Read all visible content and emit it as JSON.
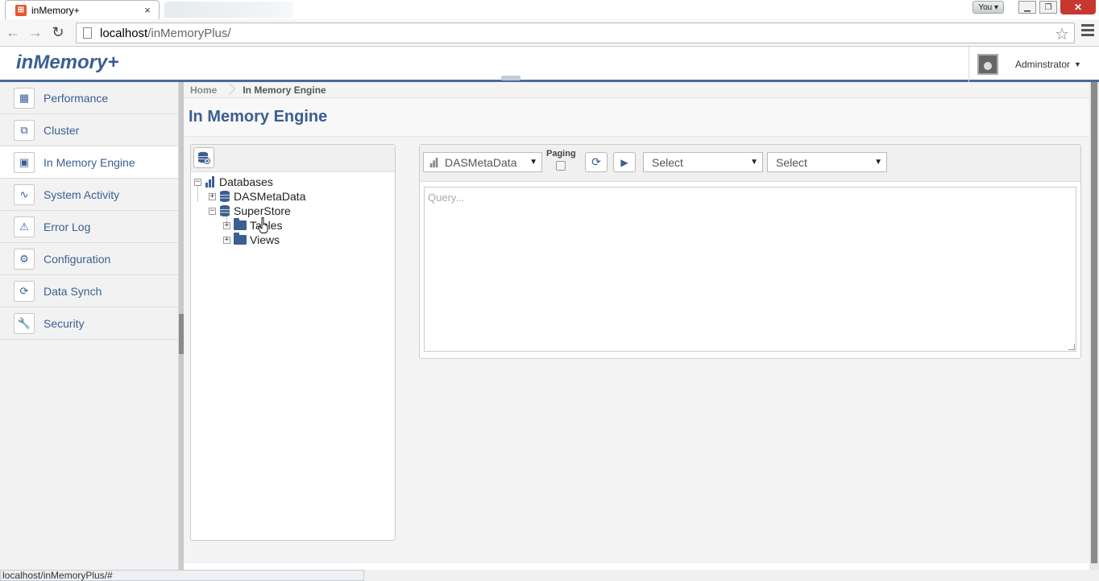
{
  "browser": {
    "tab_title": "inMemory+",
    "tab_close": "×",
    "url_host": "localhost",
    "url_path": "/inMemoryPlus/",
    "profile_label": "You",
    "status_url": "localhost/inMemoryPlus/#"
  },
  "header": {
    "logo": "inMemory+",
    "user_name": "Adminstrator"
  },
  "sidebar": {
    "items": [
      {
        "label": "Performance",
        "icon": "performance-icon"
      },
      {
        "label": "Cluster",
        "icon": "cluster-icon"
      },
      {
        "label": "In Memory Engine",
        "icon": "engine-icon",
        "active": true
      },
      {
        "label": "System Activity",
        "icon": "activity-icon"
      },
      {
        "label": "Error Log",
        "icon": "warning-icon"
      },
      {
        "label": "Configuration",
        "icon": "gear-icon"
      },
      {
        "label": "Data Synch",
        "icon": "sync-icon"
      },
      {
        "label": "Security",
        "icon": "key-icon"
      }
    ]
  },
  "breadcrumb": {
    "home": "Home",
    "current": "In Memory Engine"
  },
  "page": {
    "title": "In Memory Engine"
  },
  "tree": {
    "root": "Databases",
    "db1": "DASMetaData",
    "db2": "SuperStore",
    "folder1": "Tables",
    "folder2": "Views"
  },
  "query": {
    "db_select": "DASMetaData",
    "paging_label": "Paging",
    "select1": "Select",
    "select2": "Select",
    "placeholder": "Query..."
  },
  "colors": {
    "accent": "#3b5e93"
  }
}
